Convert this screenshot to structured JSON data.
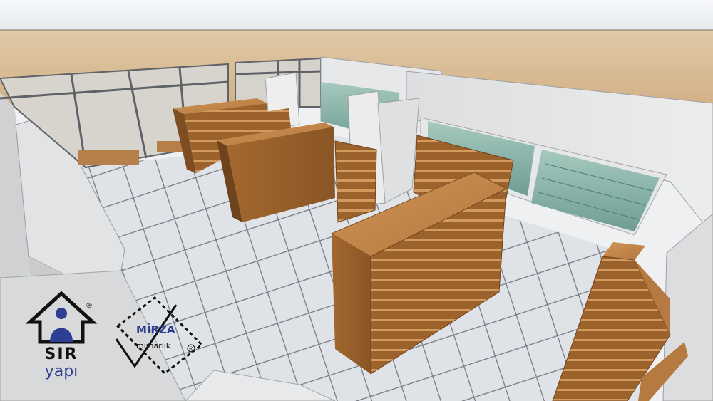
{
  "scene": {
    "description_colors": {
      "sky_top": "#f4f6f9",
      "sky_bottom": "#e9ecef",
      "ground_far": "#dcc29e",
      "ground_near": "#d4b48b",
      "floor_tile": "#dde1e5",
      "floor_grout": "#7b8087",
      "wall_white": "#e6e7e8",
      "wall_shadow": "#c8cacc",
      "window_frame": "#6a6e73",
      "wood_light": "#c58a4e",
      "wood_mid": "#a86c34",
      "wood_dark": "#7d4e22",
      "glass_green": "#8fb8ad",
      "glass_green_dark": "#5f8f84"
    }
  },
  "logos": {
    "sir_yapi": {
      "line1": "SIR",
      "line2": "yapı",
      "registered": "®",
      "colors": {
        "ink": "#111111",
        "blue": "#2e3f93"
      }
    },
    "mirza": {
      "line1": "MİRZA",
      "line2": "mimarlık",
      "registered": "®",
      "colors": {
        "blue": "#2e3f93",
        "ink": "#111111"
      }
    }
  }
}
